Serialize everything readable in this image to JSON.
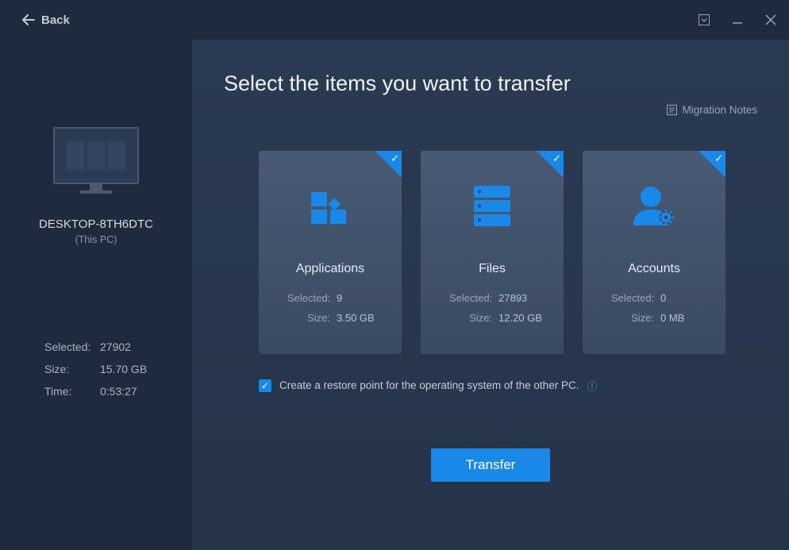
{
  "back_label": "Back",
  "sidebar": {
    "pc_name": "DESKTOP-8TH6DTC",
    "pc_sub": "(This PC)",
    "stats": {
      "selected_label": "Selected:",
      "selected_value": "27902",
      "size_label": "Size:",
      "size_value": "15.70 GB",
      "time_label": "Time:",
      "time_value": "0:53:27"
    }
  },
  "main": {
    "title": "Select the items you want to transfer",
    "notes_label": "Migration Notes",
    "cards": [
      {
        "title": "Applications",
        "selected_label": "Selected:",
        "selected_value": "9",
        "size_label": "Size:",
        "size_value": "3.50 GB"
      },
      {
        "title": "Files",
        "selected_label": "Selected:",
        "selected_value": "27893",
        "size_label": "Size:",
        "size_value": "12.20 GB"
      },
      {
        "title": "Accounts",
        "selected_label": "Selected:",
        "selected_value": "0",
        "size_label": "Size:",
        "size_value": "0 MB"
      }
    ],
    "restore_label": "Create a restore point for the operating system of the other PC.",
    "transfer_label": "Transfer"
  }
}
